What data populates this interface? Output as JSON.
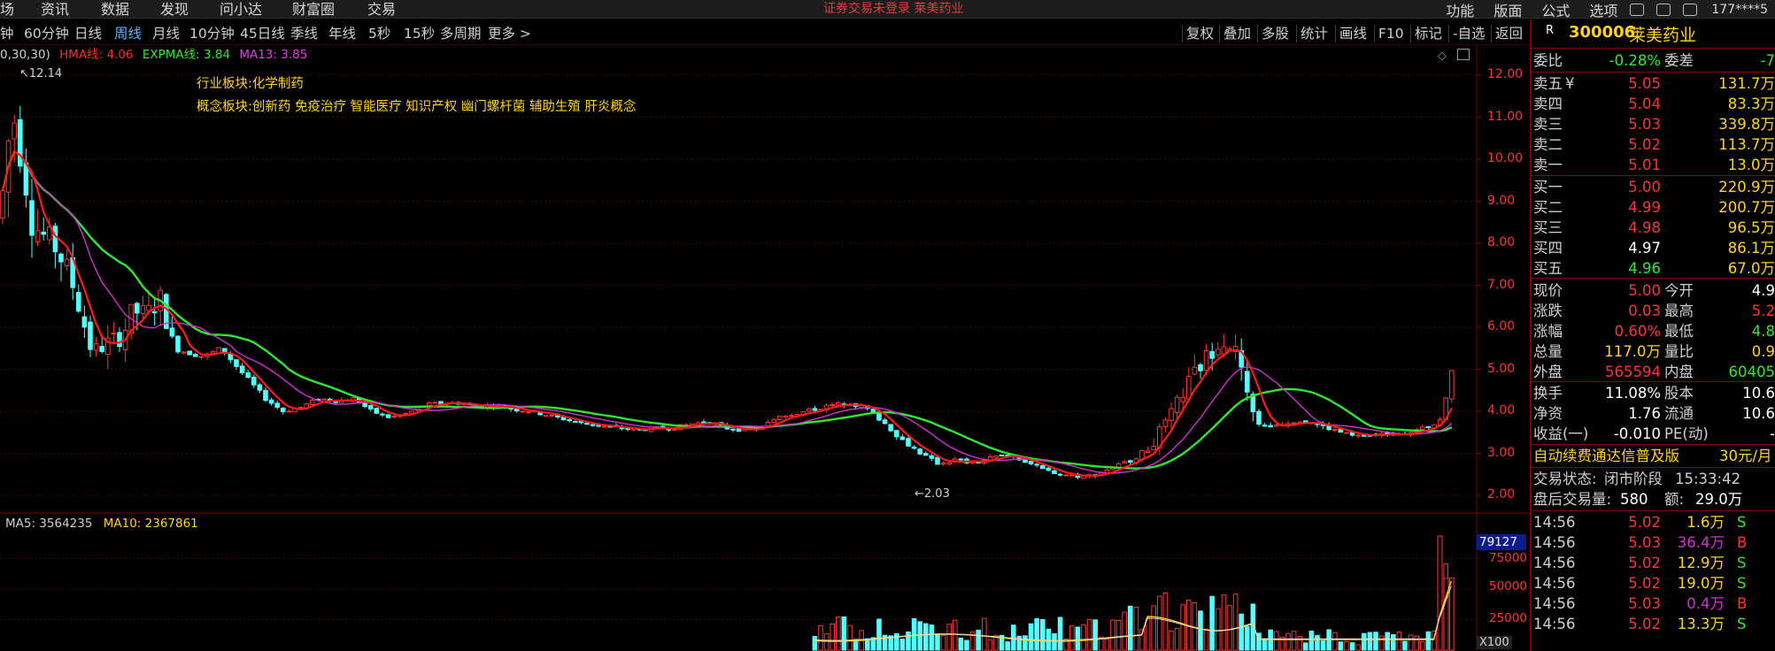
{
  "top_menu": {
    "left_items": [
      "场",
      "资讯",
      "数据",
      "发现",
      "问小达",
      "财富圈",
      "交易"
    ],
    "center_notice": "证券交易未登录  莱美药业",
    "right_items": [
      "功能",
      "版面",
      "公式",
      "选项"
    ],
    "user": "177****5"
  },
  "period_bar": {
    "items": [
      "钟",
      "60分钟",
      "日线",
      "周线",
      "月线",
      "10分钟",
      "45日线",
      "季线",
      "年线",
      "5秒",
      "15秒",
      "多周期",
      "更多 >"
    ],
    "active": "周线",
    "tools": [
      "复权",
      "叠加",
      "多股",
      "统计",
      "画线",
      "F10",
      "标记",
      "-自选",
      "返回"
    ]
  },
  "indicator_legend": {
    "params": "0,30,30)",
    "hma": "HMA线: 4.06",
    "expma": "EXPMA线: 3.84",
    "ma13": "MA13: 3.85"
  },
  "sector": {
    "industry": "行业板块:化学制药",
    "concept": "概念板块:创新药 免疫治疗 智能医疗 知识产权 幽门螺杆菌 辅助生殖 肝炎概念"
  },
  "annotations": {
    "high": "12.14",
    "low": "2.03"
  },
  "price_axis": [
    "12.00",
    "11.00",
    "10.00",
    "9.00",
    "8.00",
    "7.00",
    "6.00",
    "5.00",
    "4.00",
    "3.00",
    "2.00"
  ],
  "volume_legend": {
    "ma5": "MA5: 3564235",
    "ma10": "MA10: 2367861"
  },
  "volume_axis": {
    "top_box": "79127",
    "ticks": [
      "75000",
      "50000",
      "25000"
    ],
    "unit": "X100"
  },
  "colors": {
    "up": "#ff3232",
    "down": "#54ffff",
    "hma": "#ff1a1a",
    "expma": "#2ee82e",
    "ma13": "#d22fd2",
    "ma10": "#ffd21f",
    "bg": "#000000"
  },
  "stock": {
    "badge": "R",
    "code": "300006",
    "name": "莱美药业"
  },
  "order_book": {
    "weibi_label": "委比",
    "weibi": "-0.28%",
    "weicha_label": "委差",
    "weicha": "-7",
    "sells": [
      {
        "label": "卖五",
        "mark": "¥",
        "price": "5.05",
        "vol": "131.7万"
      },
      {
        "label": "卖四",
        "mark": "",
        "price": "5.04",
        "vol": "83.3万"
      },
      {
        "label": "卖三",
        "mark": "",
        "price": "5.03",
        "vol": "339.8万"
      },
      {
        "label": "卖二",
        "mark": "",
        "price": "5.02",
        "vol": "113.7万"
      },
      {
        "label": "卖一",
        "mark": "",
        "price": "5.01",
        "vol": "13.0万"
      }
    ],
    "buys": [
      {
        "label": "买一",
        "price": "5.00",
        "vol": "220.9万",
        "color": "#ff3232"
      },
      {
        "label": "买二",
        "price": "4.99",
        "vol": "200.7万",
        "color": "#ff3232"
      },
      {
        "label": "买三",
        "price": "4.98",
        "vol": "96.5万",
        "color": "#ff3232"
      },
      {
        "label": "买四",
        "price": "4.97",
        "vol": "86.1万",
        "color": "#ffffff"
      },
      {
        "label": "买五",
        "price": "4.96",
        "vol": "67.0万",
        "color": "#2ee82e"
      }
    ]
  },
  "quote": [
    {
      "l1": "现价",
      "v1": "5.00",
      "c1": "#ff3232",
      "l2": "今开",
      "v2": "4.9",
      "c2": "#ffffff"
    },
    {
      "l1": "涨跌",
      "v1": "0.03",
      "c1": "#ff3232",
      "l2": "最高",
      "v2": "5.2",
      "c2": "#ff3232"
    },
    {
      "l1": "涨幅",
      "v1": "0.60%",
      "c1": "#ff3232",
      "l2": "最低",
      "v2": "4.8",
      "c2": "#2ee82e"
    },
    {
      "l1": "总量",
      "v1": "117.0万",
      "c1": "#ffd21f",
      "l2": "量比",
      "v2": "0.9",
      "c2": "#ffd21f"
    },
    {
      "l1": "外盘",
      "v1": "565594",
      "c1": "#ff3232",
      "l2": "内盘",
      "v2": "60405",
      "c2": "#2ee82e"
    }
  ],
  "fundamentals": [
    {
      "l1": "换手",
      "v1": "11.08%",
      "l2": "股本",
      "v2": "10.6"
    },
    {
      "l1": "净资",
      "v1": "1.76",
      "l2": "流通",
      "v2": "10.6"
    },
    {
      "l1": "收益(一)",
      "v1": "-0.010",
      "l2": "PE(动)",
      "v2": "-"
    }
  ],
  "ad": {
    "text": "自动续费通达信普及版",
    "price": "30元/月"
  },
  "trade_status": {
    "label": "交易状态:",
    "value": "闭市阶段",
    "time": "15:33:42"
  },
  "after_hours": {
    "label": "盘后交易量:",
    "vol": "580",
    "amt_label": "额:",
    "amt": "29.0万"
  },
  "ticks": [
    {
      "time": "14:56",
      "price": "5.02",
      "vol": "1.6万",
      "side": "S"
    },
    {
      "time": "14:56",
      "price": "5.03",
      "vol": "36.4万",
      "side": "B"
    },
    {
      "time": "14:56",
      "price": "5.02",
      "vol": "12.9万",
      "side": "S"
    },
    {
      "time": "14:56",
      "price": "5.02",
      "vol": "19.0万",
      "side": "S"
    },
    {
      "time": "14:56",
      "price": "5.03",
      "vol": "0.4万",
      "side": "B"
    },
    {
      "time": "14:56",
      "price": "5.02",
      "vol": "13.3万",
      "side": "S"
    }
  ],
  "tick_extra": {
    "b_count": "2"
  }
}
